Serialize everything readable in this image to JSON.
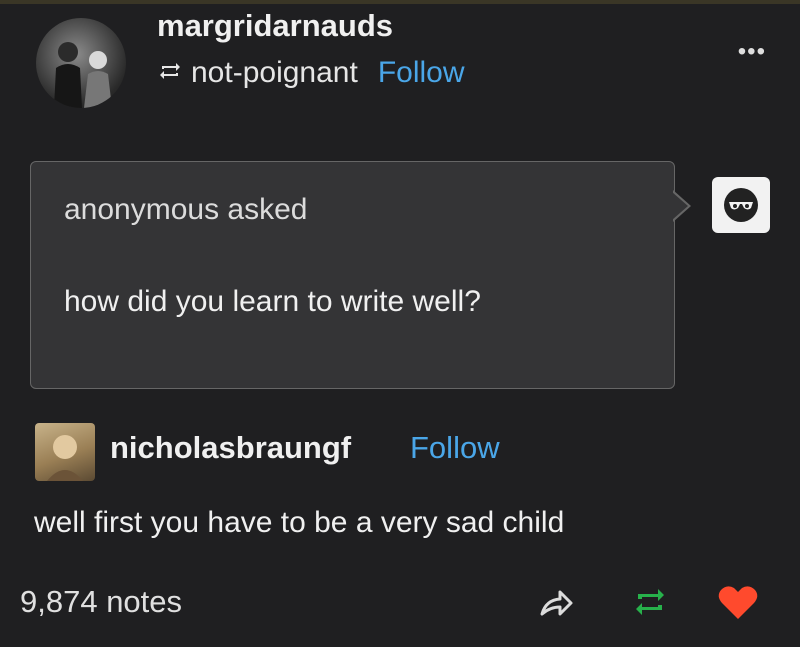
{
  "post": {
    "author": "margridarnauds",
    "reblogged_from": "not-poignant",
    "follow_label": "Follow",
    "more_label": "•••"
  },
  "ask": {
    "asker": "anonymous asked",
    "question": "how did you learn to write well?"
  },
  "reply": {
    "username": "nicholasbraungf",
    "follow_label": "Follow",
    "text": "well first you have to be a very sad child"
  },
  "footer": {
    "notes": "9,874 notes"
  },
  "icons": {
    "reblog_small": "reblog-icon",
    "anonymous": "anonymous-sunglasses-icon",
    "share": "share-icon",
    "reblog": "reblog-icon",
    "like": "heart-icon"
  },
  "colors": {
    "background": "#1f1f21",
    "follow": "#4aa6e8",
    "reblog": "#27b14b",
    "like": "#ff4a2d"
  }
}
